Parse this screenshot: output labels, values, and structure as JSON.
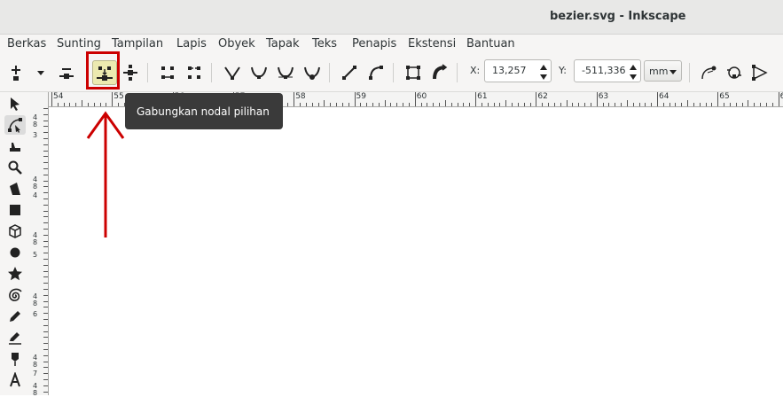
{
  "window": {
    "title": "bezier.svg - Inkscape"
  },
  "menu": [
    "Berkas",
    "Sunting",
    "Tampilan",
    "Lapis",
    "Obyek",
    "Tapak",
    "Teks",
    "Penapis",
    "Ekstensi",
    "Bantuan"
  ],
  "toolbar": {
    "x_label": "X:",
    "x_value": "13,257",
    "y_label": "Y:",
    "y_value": "-511,336",
    "unit": "mm"
  },
  "tooltip": {
    "text": "Gabungkan nodal pilihan"
  },
  "ruler": {
    "h_labels": [
      "54",
      "55",
      "56",
      "57",
      "58",
      "59",
      "60",
      "61",
      "62",
      "63",
      "64",
      "65",
      "66"
    ],
    "v_labels": [
      "4",
      "8",
      "3",
      "4",
      "8",
      "4",
      "4",
      "8",
      "5",
      "4",
      "8",
      "6",
      "4",
      "8",
      "7",
      "4",
      "8"
    ]
  },
  "colors": {
    "highlight": "#cc0000",
    "tooltip_bg": "#3a3a3a",
    "active_button": "#eceab0"
  }
}
